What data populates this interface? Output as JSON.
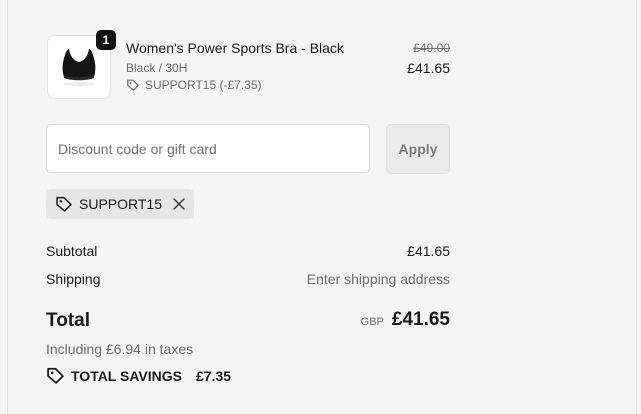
{
  "product": {
    "quantity": "1",
    "title": "Women's Power Sports Bra - Black",
    "variant": "Black / 30H",
    "discount_line": "SUPPORT15 (-£7.35)",
    "price_original": "£49.00",
    "price_current": "£41.65",
    "thumbnail_icon": "sports-bra-image"
  },
  "discount_form": {
    "placeholder": "Discount code or gift card",
    "value": "",
    "apply_label": "Apply"
  },
  "applied_code": {
    "code": "SUPPORT15",
    "tag_icon": "tag-icon",
    "remove_icon": "close-icon"
  },
  "summary": {
    "subtotal_label": "Subtotal",
    "subtotal_value": "£41.65",
    "shipping_label": "Shipping",
    "shipping_value": "Enter shipping address",
    "total_label": "Total",
    "currency": "GBP",
    "total_value": "£41.65",
    "taxes_note": "Including £6.94 in taxes",
    "savings_label": "TOTAL SAVINGS",
    "savings_value": "£7.35"
  },
  "colors": {
    "background": "#f5f5f5",
    "text": "#1a1a1a",
    "muted": "#6b6b6b",
    "badge": "#111111"
  }
}
